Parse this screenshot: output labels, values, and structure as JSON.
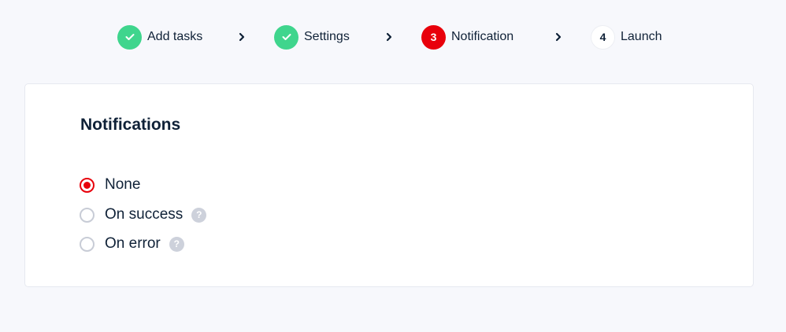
{
  "stepper": {
    "steps": [
      {
        "label": "Add tasks",
        "state": "done",
        "icon": "check-icon"
      },
      {
        "label": "Settings",
        "state": "done",
        "icon": "check-icon"
      },
      {
        "label": "Notification",
        "state": "active",
        "number": "3"
      },
      {
        "label": "Launch",
        "state": "pending",
        "number": "4"
      }
    ],
    "separator_icon": "chevron-right-icon"
  },
  "notifications": {
    "title": "Notifications",
    "options": [
      {
        "label": "None",
        "selected": true
      },
      {
        "label": "On success",
        "selected": false,
        "help": "?"
      },
      {
        "label": "On error",
        "selected": false,
        "help": "?"
      }
    ]
  },
  "colors": {
    "done": "#3fd58d",
    "active": "#e8000b",
    "text": "#0f2137",
    "background": "#f7f8fc"
  }
}
